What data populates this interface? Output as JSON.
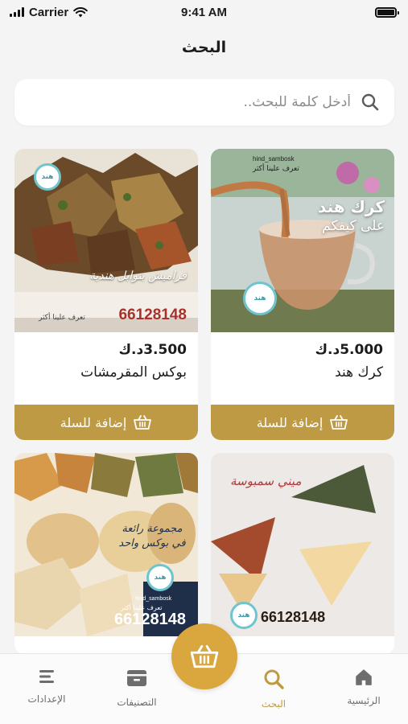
{
  "status_bar": {
    "carrier": "Carrier",
    "time": "9:41 AM"
  },
  "header": {
    "title": "البحث"
  },
  "search": {
    "placeholder": "أدخل كلمة للبحث..",
    "value": ""
  },
  "products": [
    {
      "name": "كرك هند",
      "price": "5.000د.ك",
      "add_label": "إضافة للسلة",
      "image_text": {
        "line1": "كرك هند",
        "line2": "على كيفكم",
        "handle": "hind_sambosk",
        "tagline": "تعرف علينا أكثر"
      }
    },
    {
      "name": "بوكس المقرمشات",
      "price": "3.500د.ك",
      "add_label": "إضافة للسلة",
      "image_text": {
        "script": "قراميش بتوابل هندية",
        "phone": "66128148",
        "tagline": "تعرف علينا أكثر"
      }
    },
    {
      "name": "",
      "price": "",
      "add_label": "",
      "image_text": {
        "script": "ميني سمبوسة",
        "phone": "66128148"
      }
    },
    {
      "name": "",
      "price": "",
      "add_label": "",
      "image_text": {
        "script": "مجموعة رائعة في بوكس واحد",
        "phone": "66128148",
        "handle": "hind_sambosk",
        "tagline": "تعرف علينا أكثر"
      }
    }
  ],
  "tabs": [
    {
      "label": "الرئيسية",
      "icon": "home-icon"
    },
    {
      "label": "البحث",
      "icon": "search-icon",
      "active": true
    },
    {
      "label": "التصنيفات",
      "icon": "categories-icon"
    },
    {
      "label": "الإعدادات",
      "icon": "settings-icon"
    }
  ],
  "colors": {
    "accent": "#bf9a45",
    "fab": "#d9a73d",
    "background": "#f4f4f5"
  }
}
